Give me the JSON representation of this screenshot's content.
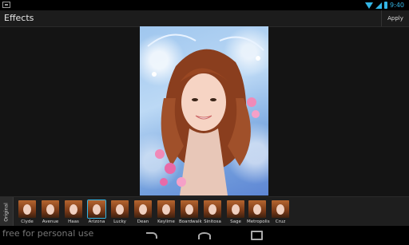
{
  "status_bar": {
    "time": "9:40"
  },
  "action_bar": {
    "title": "Effects",
    "apply_label": "Apply"
  },
  "film_strip": {
    "original_label": "Original",
    "selected": "Arizona",
    "effects": [
      "Clyde",
      "Avenue",
      "Haas",
      "Arizona",
      "Lucky",
      "Dean",
      "Keylime",
      "Boardwalk",
      "Sinitosa",
      "Sage",
      "Metropolis",
      "Cruz"
    ]
  },
  "footer": {
    "watermark": "free for personal use"
  }
}
